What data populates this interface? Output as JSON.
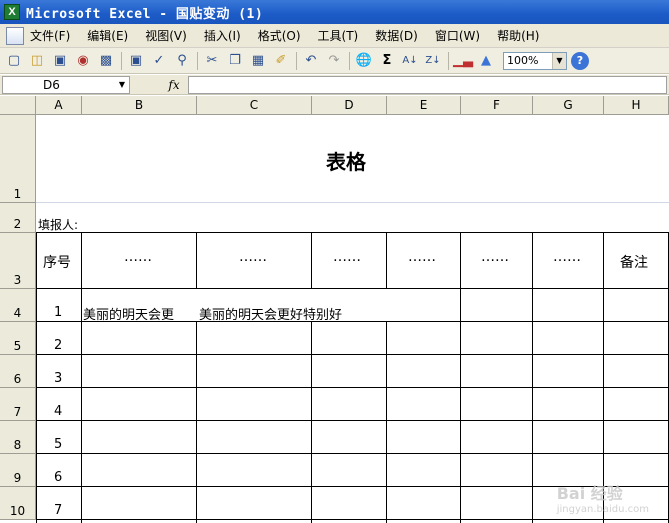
{
  "window": {
    "title": "Microsoft Excel - 国贴变动 (1)",
    "app_icon": "X"
  },
  "menu": [
    "文件(F)",
    "编辑(E)",
    "视图(V)",
    "插入(I)",
    "格式(O)",
    "工具(T)",
    "数据(D)",
    "窗口(W)",
    "帮助(H)"
  ],
  "toolbar": {
    "icons": [
      "new-icon",
      "open-icon",
      "save-icon",
      "permission-icon",
      "print-icon",
      "print-preview-icon",
      "spelling-icon",
      "research-icon",
      "cut-icon",
      "copy-icon",
      "paste-icon",
      "format-painter-icon",
      "undo-icon",
      "redo-icon",
      "hyperlink-icon",
      "autosum-icon",
      "sort-ascending-icon",
      "sort-descending-icon",
      "chart-icon",
      "drawing-icon"
    ],
    "zoom": "100%",
    "help": "?"
  },
  "formula_bar": {
    "name_box": "D6",
    "fx": "fx",
    "formula": ""
  },
  "columns": [
    "A",
    "B",
    "C",
    "D",
    "E",
    "F",
    "G",
    "H"
  ],
  "rows": [
    "1",
    "2",
    "3",
    "4",
    "5",
    "6",
    "7",
    "8",
    "9",
    "10"
  ],
  "sheet": {
    "title": "表格",
    "filler_label": "填报人:",
    "headers": [
      "序号",
      "……",
      "……",
      "……",
      "……",
      "……",
      "……",
      "备注"
    ],
    "row_numbers": [
      "1",
      "2",
      "3",
      "4",
      "5",
      "6",
      "7"
    ],
    "b4": "美丽的明天会更",
    "c4": "美丽的明天会更好特别好"
  },
  "watermark": {
    "brand": "Bai 经验",
    "url": "jingyan.baidu.com"
  }
}
